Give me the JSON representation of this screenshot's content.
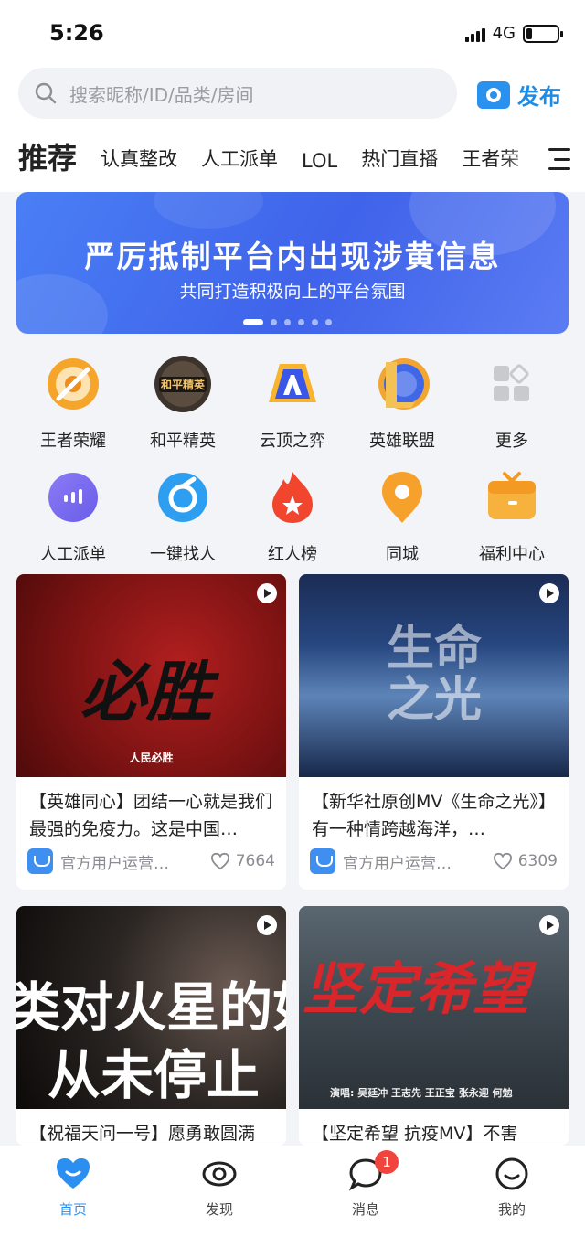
{
  "status_bar": {
    "time": "5:26",
    "network": "4G",
    "battery_level_pct": 18
  },
  "search": {
    "placeholder": "搜索昵称/ID/品类/房间"
  },
  "publish": {
    "label": "发布"
  },
  "tabs": [
    {
      "label": "推荐",
      "active": true
    },
    {
      "label": "认真整改"
    },
    {
      "label": "人工派单"
    },
    {
      "label": "LOL"
    },
    {
      "label": "热门直播"
    },
    {
      "label": "王者荣"
    }
  ],
  "banner": {
    "title": "严厉抵制平台内出现涉黄信息",
    "subtitle": "共同打造积极向上的平台氛围",
    "slides": 6,
    "active_slide": 1
  },
  "categories": [
    {
      "label": "王者荣耀",
      "icon": "honor-of-kings-icon"
    },
    {
      "label": "和平精英",
      "icon": "peace-elite-icon",
      "icon_text": "和平精英"
    },
    {
      "label": "云顶之弈",
      "icon": "tft-icon"
    },
    {
      "label": "英雄联盟",
      "icon": "lol-icon"
    },
    {
      "label": "更多",
      "icon": "more-grid-icon"
    },
    {
      "label": "人工派单",
      "icon": "voice-icon"
    },
    {
      "label": "一键找人",
      "icon": "find-person-icon"
    },
    {
      "label": "红人榜",
      "icon": "fire-icon"
    },
    {
      "label": "同城",
      "icon": "location-icon"
    },
    {
      "label": "福利中心",
      "icon": "gift-icon"
    }
  ],
  "cards": [
    {
      "caption": "【英雄同心】团结一心就是我们最强的免疫力。这是中国…",
      "author": "官方用户运营…",
      "likes": "7664",
      "thumb_text": "必胜",
      "thumb_sub": "人民必胜"
    },
    {
      "caption": "【新华社原创MV《生命之光》】有一种情跨越海洋，…",
      "author": "官方用户运营…",
      "likes": "6309",
      "thumb_text": "生命之光"
    },
    {
      "caption": "【祝福天问一号】愿勇敢圆满",
      "thumb_text_line1": "类对火星的如",
      "thumb_text_line2": "从未停止"
    },
    {
      "caption": "【坚定希望 抗疫MV】不害",
      "thumb_text": "坚定希望",
      "thumb_sub": "演唱: 吴廷冲 王志先 王正宝 张永迎 何勉"
    }
  ],
  "bottom_nav": [
    {
      "label": "首页",
      "icon": "heart-home-icon",
      "active": true
    },
    {
      "label": "发现",
      "icon": "eye-icon"
    },
    {
      "label": "消息",
      "icon": "chat-bubble-icon",
      "badge": "1"
    },
    {
      "label": "我的",
      "icon": "smile-face-icon"
    }
  ],
  "colors": {
    "accent": "#1b8de8",
    "badge": "#f0443c",
    "banner": "#3f63ea"
  }
}
